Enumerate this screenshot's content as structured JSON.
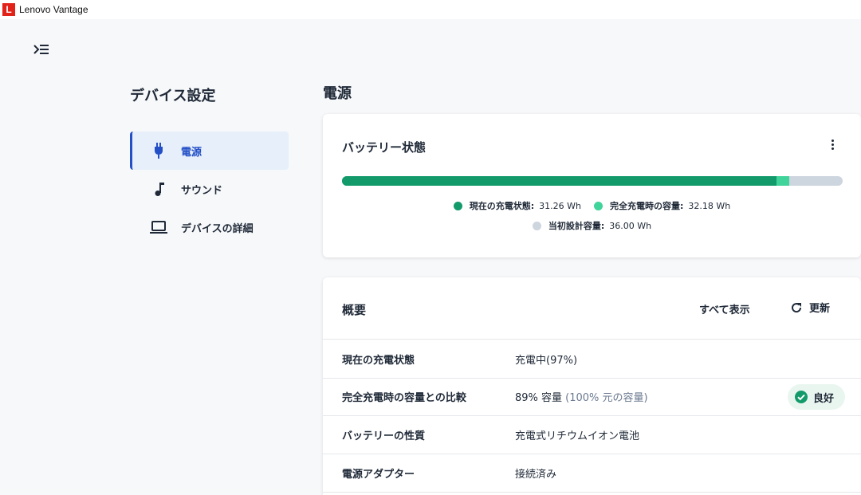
{
  "window": {
    "logo_letter": "L",
    "title": "Lenovo Vantage"
  },
  "sidebar": {
    "title": "デバイス設定",
    "items": [
      {
        "label": "電源",
        "icon": "power-plug-icon",
        "active": true
      },
      {
        "label": "サウンド",
        "icon": "music-note-icon",
        "active": false
      },
      {
        "label": "デバイスの詳細",
        "icon": "laptop-icon",
        "active": false
      }
    ]
  },
  "main": {
    "page_title": "電源",
    "battery": {
      "title": "バッテリー状態",
      "menu_icon": "more-vertical-icon",
      "current_fraction_of_design": 0.8683,
      "full_fraction_of_design": 0.8939,
      "colors": {
        "current": "#139a6b",
        "full": "#40d49a",
        "design": "#cdd5df"
      },
      "legend": [
        {
          "label": "現在の充電状態:",
          "value": "31.26 Wh",
          "color": "#139a6b"
        },
        {
          "label": "完全充電時の容量:",
          "value": "32.18 Wh",
          "color": "#40d49a"
        },
        {
          "label": "当初設計容量:",
          "value": "36.00 Wh",
          "color": "#cdd5df"
        }
      ]
    },
    "summary": {
      "title": "概要",
      "show_all_label": "すべて表示",
      "refresh_label": "更新",
      "rows": [
        {
          "label": "現在の充電状態",
          "value": "充電中(97%)",
          "value_muted": ""
        },
        {
          "label": "完全充電時の容量との比較",
          "value": "89% 容量",
          "value_muted": "(100% 元の容量)",
          "badge": "良好"
        },
        {
          "label": "バッテリーの性質",
          "value": "充電式リチウムイオン電池",
          "value_muted": ""
        },
        {
          "label": "電源アダプター",
          "value": "接続済み",
          "value_muted": ""
        }
      ]
    }
  }
}
